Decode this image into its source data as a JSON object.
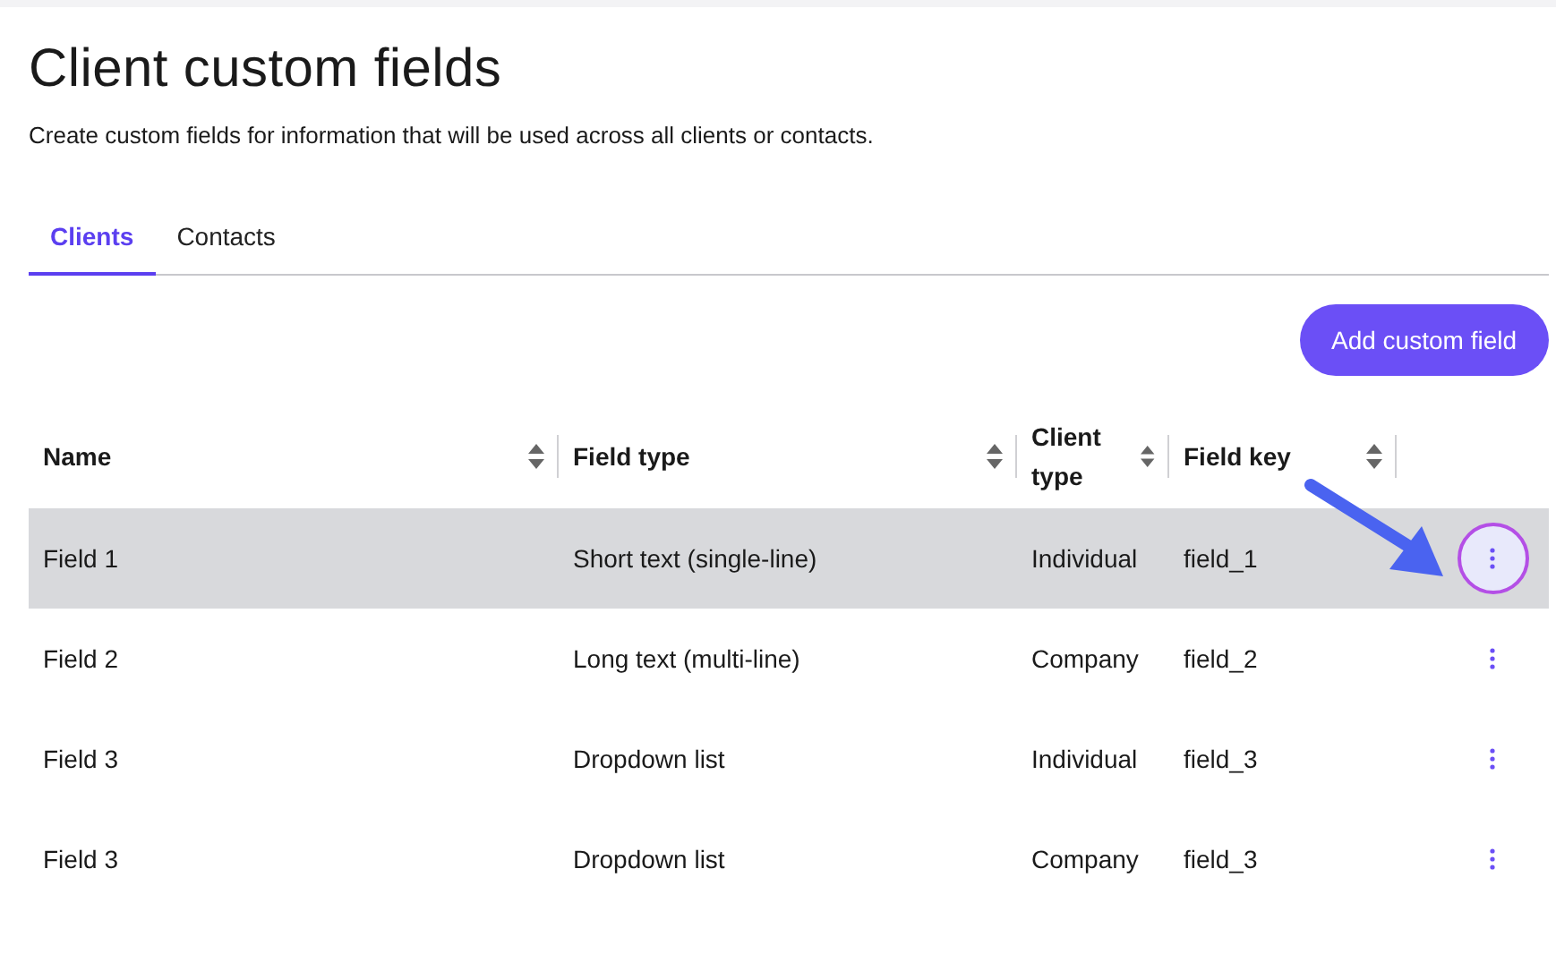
{
  "page": {
    "title": "Client custom fields",
    "subtitle": "Create custom fields for information that will be used across all clients or contacts."
  },
  "tabs": [
    {
      "label": "Clients",
      "selected": true
    },
    {
      "label": "Contacts",
      "selected": false
    }
  ],
  "add_button": {
    "label": "Add custom field"
  },
  "table": {
    "columns": [
      {
        "label": "Name"
      },
      {
        "label": "Field type"
      },
      {
        "label": "Client type"
      },
      {
        "label": "Field key"
      }
    ],
    "rows": [
      {
        "name": "Field 1",
        "field_type": "Short text (single-line)",
        "client_type": "Individual",
        "field_key": "field_1",
        "selected": true
      },
      {
        "name": "Field 2",
        "field_type": "Long text (multi-line)",
        "client_type": "Company",
        "field_key": "field_2",
        "selected": false
      },
      {
        "name": "Field 3",
        "field_type": "Dropdown list",
        "client_type": "Individual",
        "field_key": "field_3",
        "selected": false
      },
      {
        "name": "Field 3",
        "field_type": "Dropdown list",
        "client_type": "Company",
        "field_key": "field_3",
        "selected": false
      }
    ]
  }
}
